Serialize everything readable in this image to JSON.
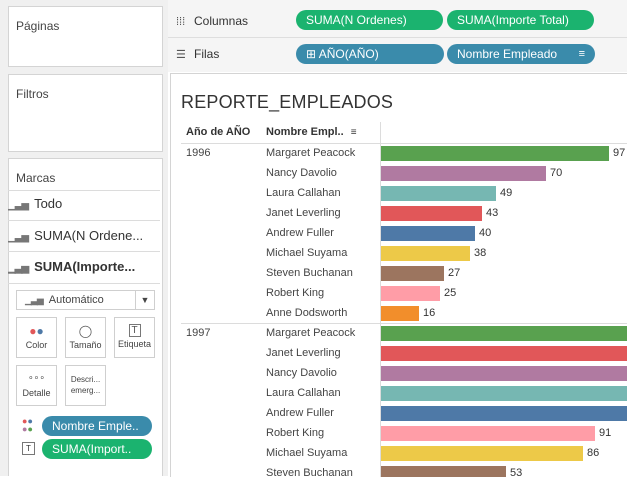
{
  "panels": {
    "pages": "Páginas",
    "filters": "Filtros",
    "marks": "Marcas"
  },
  "marks": {
    "rows": [
      "Todo",
      "SUMA(N Ordene...",
      "SUMA(Importe..."
    ],
    "mark_type": "Automático",
    "cards": [
      "Color",
      "Tamaño",
      "Etiqueta",
      "Detalle",
      "Descri... emerg..."
    ],
    "fields": [
      {
        "icon": "color-dots-icon",
        "label": "Nombre Emple.."
      },
      {
        "icon": "text-T-icon",
        "label": "SUMA(Import.."
      }
    ]
  },
  "shelves": {
    "columns_label": "Columnas",
    "rows_label": "Filas",
    "column_pills": [
      "SUMA(N Ordenes)",
      "SUMA(Importe Total)"
    ],
    "row_pills": [
      "⊞ AÑO(AÑO)",
      "Nombre Empleado"
    ]
  },
  "viz": {
    "title": "REPORTE_EMPLEADOS",
    "header_year": "Año de AÑO",
    "header_employee": "Nombre Empl.."
  },
  "colors": {
    "Margaret Peacock": "#59a14f",
    "Nancy Davolio": "#b07aa1",
    "Laura Callahan": "#76b7b2",
    "Janet Leverling": "#e15759",
    "Andrew Fuller": "#4e79a7",
    "Michael Suyama": "#edc948",
    "Steven Buchanan": "#9c755f",
    "Robert King": "#ff9da7",
    "Anne Dodsworth": "#f28e2b"
  },
  "chart_data": {
    "type": "bar",
    "title": "REPORTE_EMPLEADOS",
    "groups": [
      {
        "year": "1996",
        "rows": [
          {
            "name": "Margaret Peacock",
            "value": 97
          },
          {
            "name": "Nancy Davolio",
            "value": 70
          },
          {
            "name": "Laura Callahan",
            "value": 49
          },
          {
            "name": "Janet Leverling",
            "value": 43
          },
          {
            "name": "Andrew Fuller",
            "value": 40
          },
          {
            "name": "Michael Suyama",
            "value": 38
          },
          {
            "name": "Steven Buchanan",
            "value": 27
          },
          {
            "name": "Robert King",
            "value": 25
          },
          {
            "name": "Anne Dodsworth",
            "value": 16
          }
        ]
      },
      {
        "year": "1997",
        "rows": [
          {
            "name": "Margaret Peacock",
            "value": null
          },
          {
            "name": "Janet Leverling",
            "value": null
          },
          {
            "name": "Nancy Davolio",
            "value": null
          },
          {
            "name": "Laura Callahan",
            "value": null
          },
          {
            "name": "Andrew Fuller",
            "value": null
          },
          {
            "name": "Robert King",
            "value": 91
          },
          {
            "name": "Michael Suyama",
            "value": 86
          },
          {
            "name": "Steven Buchanan",
            "value": 53
          }
        ]
      }
    ]
  }
}
